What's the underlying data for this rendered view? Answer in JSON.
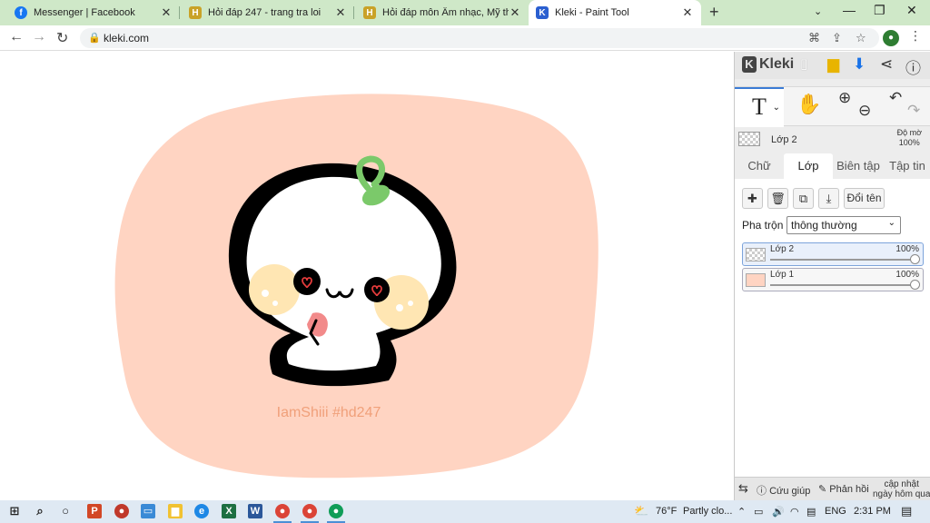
{
  "browser": {
    "tabs": [
      {
        "title": "Messenger | Facebook",
        "favicon_text": "f",
        "favicon_color": "#1877f2"
      },
      {
        "title": "Hỏi đáp 247 - trang tra loi",
        "favicon_text": "H",
        "favicon_color": "#c9a227"
      },
      {
        "title": "Hỏi đáp môn Âm nhạc, Mỹ thuật",
        "favicon_text": "H",
        "favicon_color": "#c9a227"
      },
      {
        "title": "Kleki - Paint Tool",
        "favicon_text": "K",
        "favicon_color": "#2a5fd0"
      }
    ],
    "url": "kleki.com"
  },
  "artwork": {
    "watermark": "IamShiii #hd247",
    "background_color": "#ffd4c2"
  },
  "sidebar": {
    "logo": "Kleki",
    "current_layer": "Lớp 2",
    "opacity_label": "Độ mờ",
    "opacity_value": "100%",
    "tabs": [
      "Chữ",
      "Lớp",
      "Biên tập",
      "Tập tin"
    ],
    "rename_label": "Đổi tên",
    "blend_label": "Pha trộn",
    "blend_value": "thông thường",
    "layers": [
      {
        "name": "Lớp 2",
        "opacity": "100%"
      },
      {
        "name": "Lớp 1",
        "opacity": "100%"
      }
    ],
    "help_label": "Cứu giúp",
    "feedback_label": "Phản hồi",
    "update_label_1": "cập nhật",
    "update_label_2": "ngày hôm qua"
  },
  "taskbar": {
    "weather_temp": "76°F",
    "weather_text": "Partly clo...",
    "lang": "ENG",
    "time": "2:31 PM"
  }
}
